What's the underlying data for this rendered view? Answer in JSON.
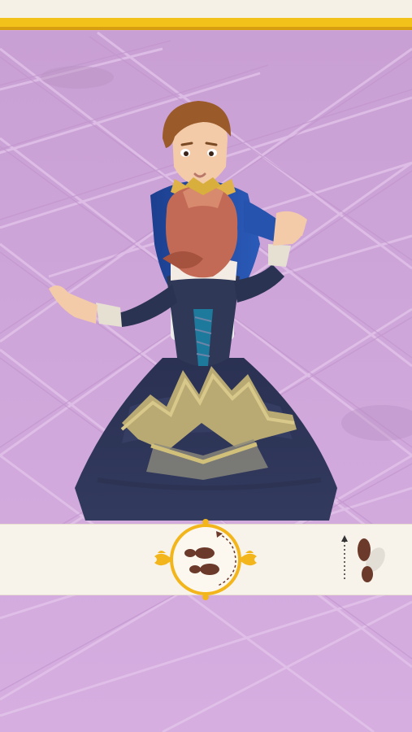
{
  "game": {
    "scene": "ballroom-dance",
    "characters": [
      "prince",
      "princess"
    ],
    "floor_color": "#d2a8dc",
    "accent_gold": "#f2c21b",
    "bar_color": "#f8f3ea",
    "step_button": {
      "icon": "footsteps-rotate-icon"
    },
    "hint": {
      "icon": "step-forward-icon"
    }
  }
}
